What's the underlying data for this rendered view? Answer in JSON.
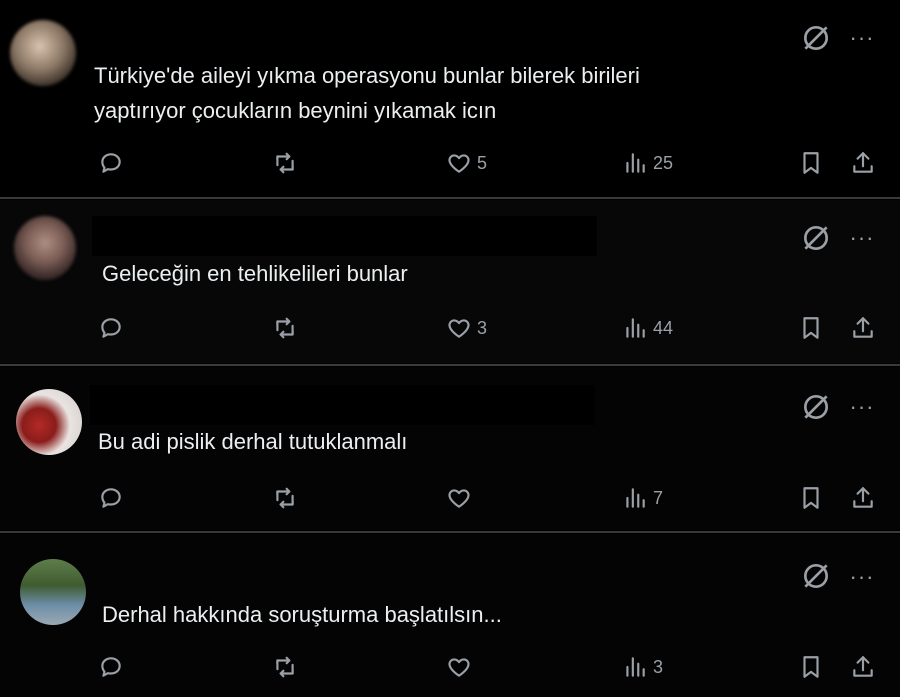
{
  "replies": [
    {
      "text_line1": "Türkiye'de aileyi yıkma operasyonu bunlar bilerek birileri",
      "text_line2": "yaptırıyor çocukların beynini yıkamak icın",
      "likes": "5",
      "views": "25"
    },
    {
      "text_line1": "Geleceğin en tehlikelileri bunlar",
      "text_line2": "",
      "likes": "3",
      "views": "44"
    },
    {
      "text_line1": "Bu adi pislik derhal tutuklanmalı",
      "text_line2": "",
      "likes": "",
      "views": "7"
    },
    {
      "text_line1": "Derhal hakkında soruşturma başlatılsın...",
      "text_line2": "",
      "likes": "",
      "views": "3"
    }
  ],
  "icons": {
    "reply": "reply-icon",
    "retweet": "retweet-icon",
    "like": "heart-icon",
    "views": "views-icon",
    "bookmark": "bookmark-icon",
    "share": "share-icon",
    "grok": "grok-icon",
    "more": "more-icon"
  },
  "colors": {
    "background": "#000000",
    "text": "#e7e9ea",
    "muted": "#9aa0a6",
    "divider": "#3a3a3a"
  }
}
